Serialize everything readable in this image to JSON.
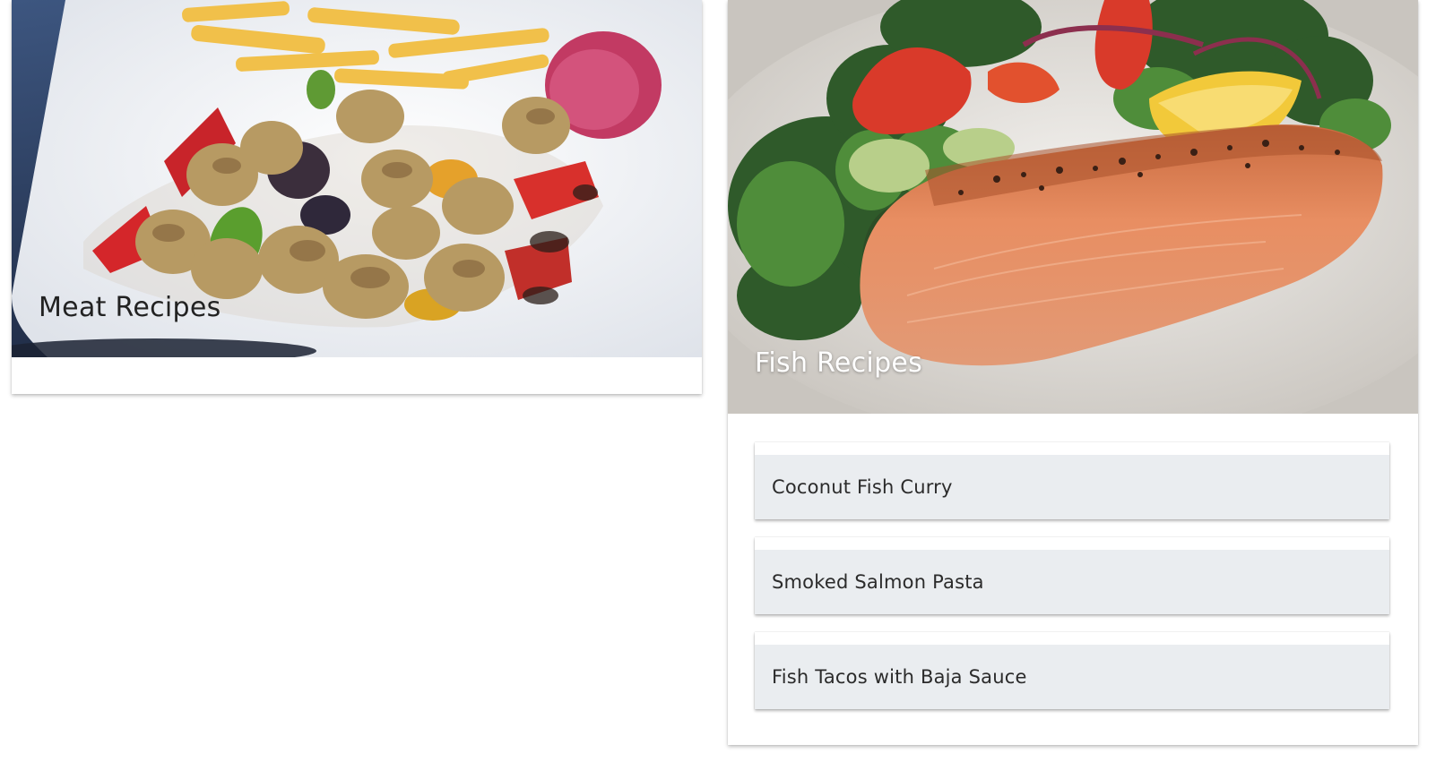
{
  "cards": [
    {
      "title": "Meat Recipes",
      "image": "grilled-meat-skewers-image"
    },
    {
      "title": "Fish Recipes",
      "image": "grilled-salmon-salad-image",
      "recipes": [
        "Coconut Fish Curry",
        "Smoked Salmon Pasta",
        "Fish Tacos with Baja Sauce"
      ]
    }
  ],
  "colors": {
    "card_background": "#ffffff",
    "list_item_background": "#eaedf0",
    "text_dark": "#222222",
    "text_light": "#ffffff"
  }
}
